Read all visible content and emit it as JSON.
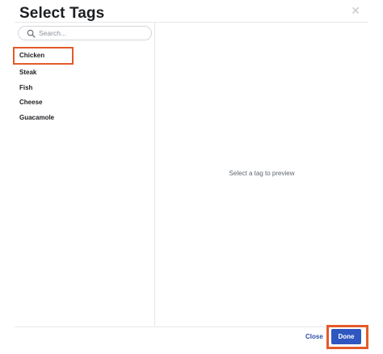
{
  "dialog": {
    "title": "Select Tags",
    "close_icon": "close-icon"
  },
  "search": {
    "placeholder": "Search...",
    "value": "",
    "icon": "search-icon"
  },
  "tags": [
    {
      "label": "Chicken",
      "selected": true
    },
    {
      "label": "Steak",
      "selected": false
    },
    {
      "label": "Fish",
      "selected": false
    },
    {
      "label": "Cheese",
      "selected": false
    },
    {
      "label": "Guacamole",
      "selected": false
    }
  ],
  "preview": {
    "empty_text": "Select a tag to preview"
  },
  "footer": {
    "close_label": "Close",
    "done_label": "Done"
  },
  "colors": {
    "highlight": "#e35a2b",
    "primary": "#2f57c2",
    "link": "#2a4fa8"
  }
}
